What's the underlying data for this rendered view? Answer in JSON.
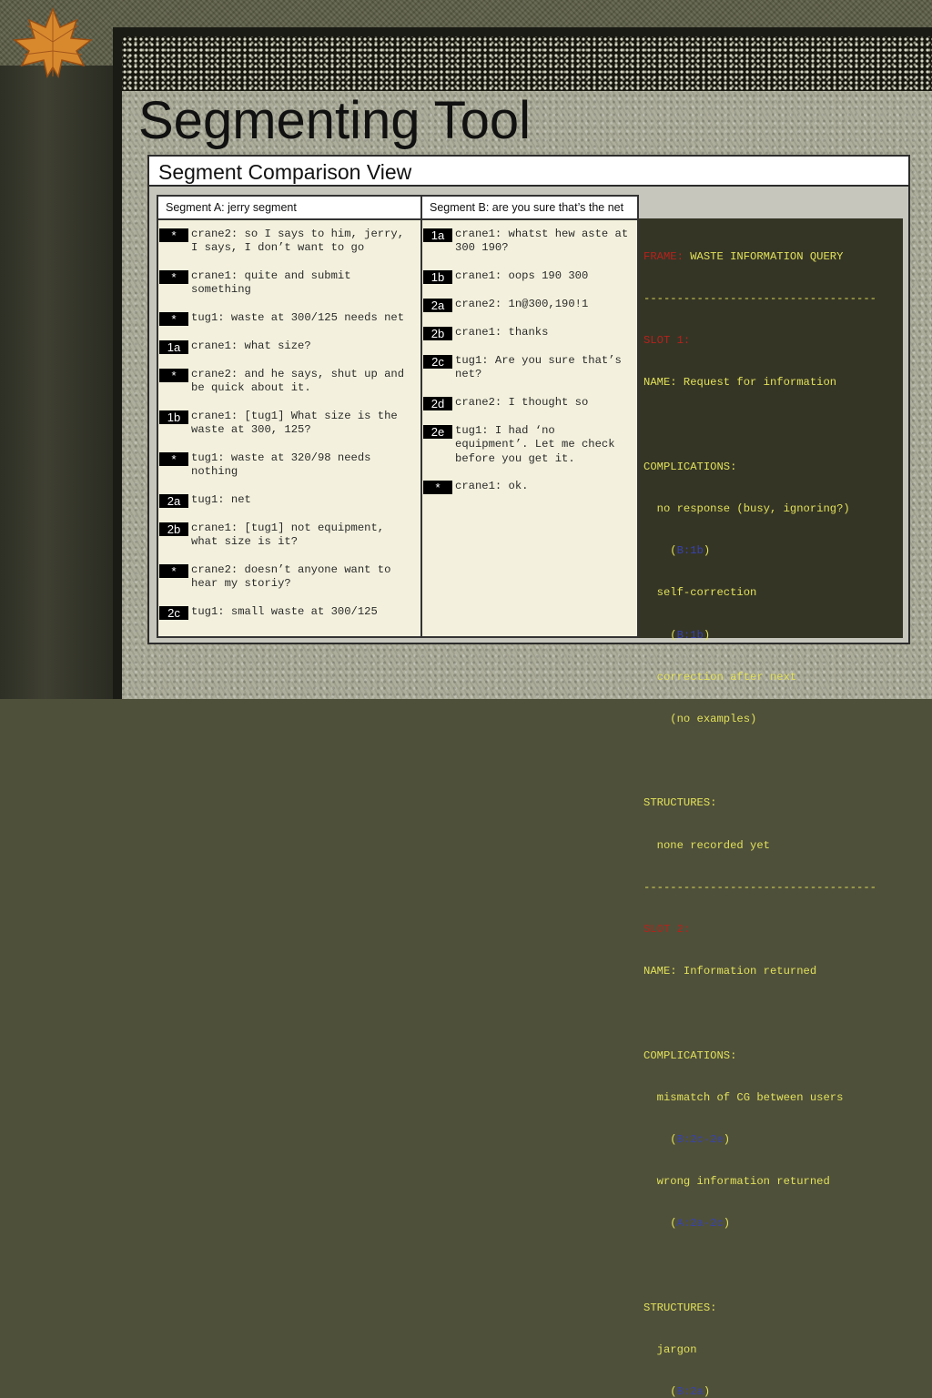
{
  "slide": {
    "title": "Segmenting Tool"
  },
  "window": {
    "title": "Segment Comparison View"
  },
  "segment_a": {
    "header": "Segment A: jerry segment",
    "rows": [
      {
        "tag": "*",
        "text": "crane2: so I says to him, jerry, I says, I don’t want to go"
      },
      {
        "tag": "*",
        "text": "crane1: quite and submit something"
      },
      {
        "tag": "*",
        "text": "tug1: waste at 300/125 needs net"
      },
      {
        "tag": "1a",
        "text": "crane1: what size?"
      },
      {
        "tag": "*",
        "text": "crane2: and he says, shut up and be quick about it."
      },
      {
        "tag": "1b",
        "text": "crane1: [tug1] What size is the waste at 300, 125?"
      },
      {
        "tag": "*",
        "text": "tug1: waste at 320/98 needs nothing"
      },
      {
        "tag": "2a",
        "text": "tug1: net"
      },
      {
        "tag": "2b",
        "text": "crane1: [tug1] not equipment, what size is it?"
      },
      {
        "tag": "*",
        "text": "crane2: doesn’t anyone want to hear my storiy?"
      },
      {
        "tag": "2c",
        "text": "tug1: small waste at 300/125"
      }
    ]
  },
  "segment_b": {
    "header": "Segment B: are you sure that’s the net",
    "rows": [
      {
        "tag": "1a",
        "text": "crane1: whatst hew aste at 300 190?"
      },
      {
        "tag": "1b",
        "text": "crane1: oops 190 300"
      },
      {
        "tag": "2a",
        "text": "crane2: 1n@300,190!1"
      },
      {
        "tag": "2b",
        "text": "crane1: thanks"
      },
      {
        "tag": "2c",
        "text": "tug1: Are you sure that’s net?"
      },
      {
        "tag": "2d",
        "text": "crane2: I thought so"
      },
      {
        "tag": "2e",
        "text": "tug1: I had ‘no equipment’. Let me check before you get it."
      },
      {
        "tag": "*",
        "text": "crane1: ok."
      }
    ]
  },
  "frame": {
    "frame_label": "FRAME:",
    "frame_name": " WASTE INFORMATION QUERY",
    "divider": "-----------------------------------",
    "slot1_label": "SLOT 1:",
    "slot1_name": "NAME: Request for information",
    "complications_label": "COMPLICATIONS:",
    "s1_c1": "  no response (busy, ignoring?)",
    "s1_c1_ref": "B:1b",
    "s1_c2": "  self-correction",
    "s1_c2_ref": "B:1b",
    "s1_c3": "  correction after next",
    "s1_c3_note": "    (no examples)",
    "structures_label": "STRUCTURES:",
    "s1_struct": "  none recorded yet",
    "slot2_label": "SLOT 2:",
    "slot2_name": "NAME: Information returned",
    "s2_c1": "  mismatch of CG between users",
    "s2_c1_ref": "B:2c-2e",
    "s2_c2": "  wrong information returned",
    "s2_c2_ref": "A:2a-2c",
    "s2_struct": "  jargon",
    "s2_struct_ref": "B:2a",
    "colors": {
      "red": "#b5221b",
      "yellow": "#e1e15a",
      "blue": "#3742b0",
      "background": "#353526"
    }
  },
  "icons": {
    "slide_decoration": "maple-leaf-icon"
  }
}
